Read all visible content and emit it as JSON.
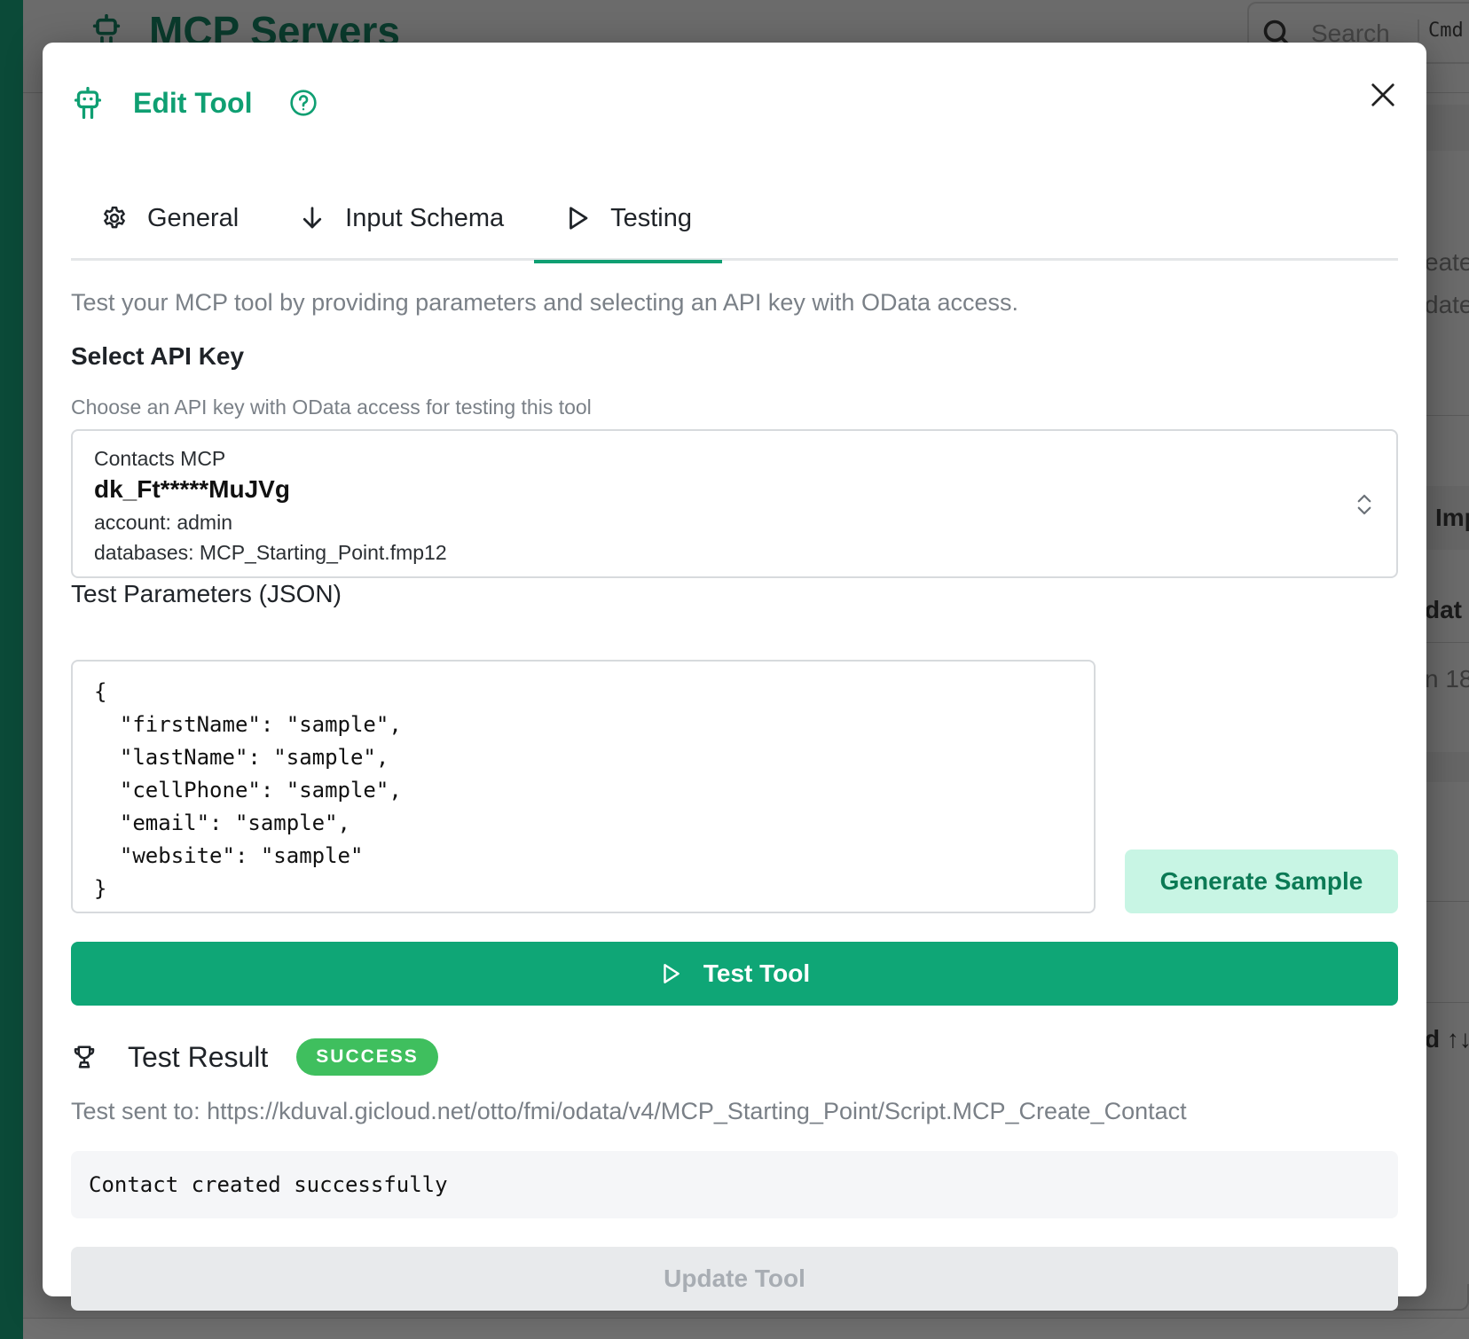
{
  "background": {
    "app_title": "MCP Servers",
    "search_placeholder": "Search",
    "search_shortcut": "Cmd",
    "peek_texts": [
      "eate",
      "date",
      "Imp",
      "dat",
      "n 18",
      "d ↑↓"
    ]
  },
  "modal": {
    "title": "Edit Tool",
    "tabs": [
      {
        "label": "General",
        "icon": "gear-icon"
      },
      {
        "label": "Input Schema",
        "icon": "arrow-down-icon"
      },
      {
        "label": "Testing",
        "icon": "play-icon",
        "active": true
      }
    ],
    "description": "Test your MCP tool by providing parameters and selecting an API key with OData access.",
    "api_key": {
      "label": "Select API Key",
      "hint": "Choose an API key with OData access for testing this tool",
      "selected": {
        "name": "Contacts MCP",
        "key": "dk_Ft*****MuJVg",
        "account": "account: admin",
        "databases": "databases: MCP_Starting_Point.fmp12"
      }
    },
    "test_params": {
      "label": "Test Parameters (JSON)",
      "value": "{\n  \"firstName\": \"sample\",\n  \"lastName\": \"sample\",\n  \"cellPhone\": \"sample\",\n  \"email\": \"sample\",\n  \"website\": \"sample\"\n}"
    },
    "generate_sample_label": "Generate Sample",
    "test_tool_label": "Test Tool",
    "result": {
      "title": "Test Result",
      "status": "SUCCESS",
      "sent_to": "Test sent to: https://kduval.gicloud.net/otto/fmi/odata/v4/MCP_Starting_Point/Script.MCP_Create_Contact",
      "output": "Contact created successfully"
    },
    "update_tool_label": "Update Tool"
  },
  "colors": {
    "accent": "#0f9f72",
    "primary_button": "#0fa676",
    "success_badge": "#3fbf5e",
    "secondary_button_bg": "#c8f5e4",
    "overlay": "#6b6b6b"
  }
}
